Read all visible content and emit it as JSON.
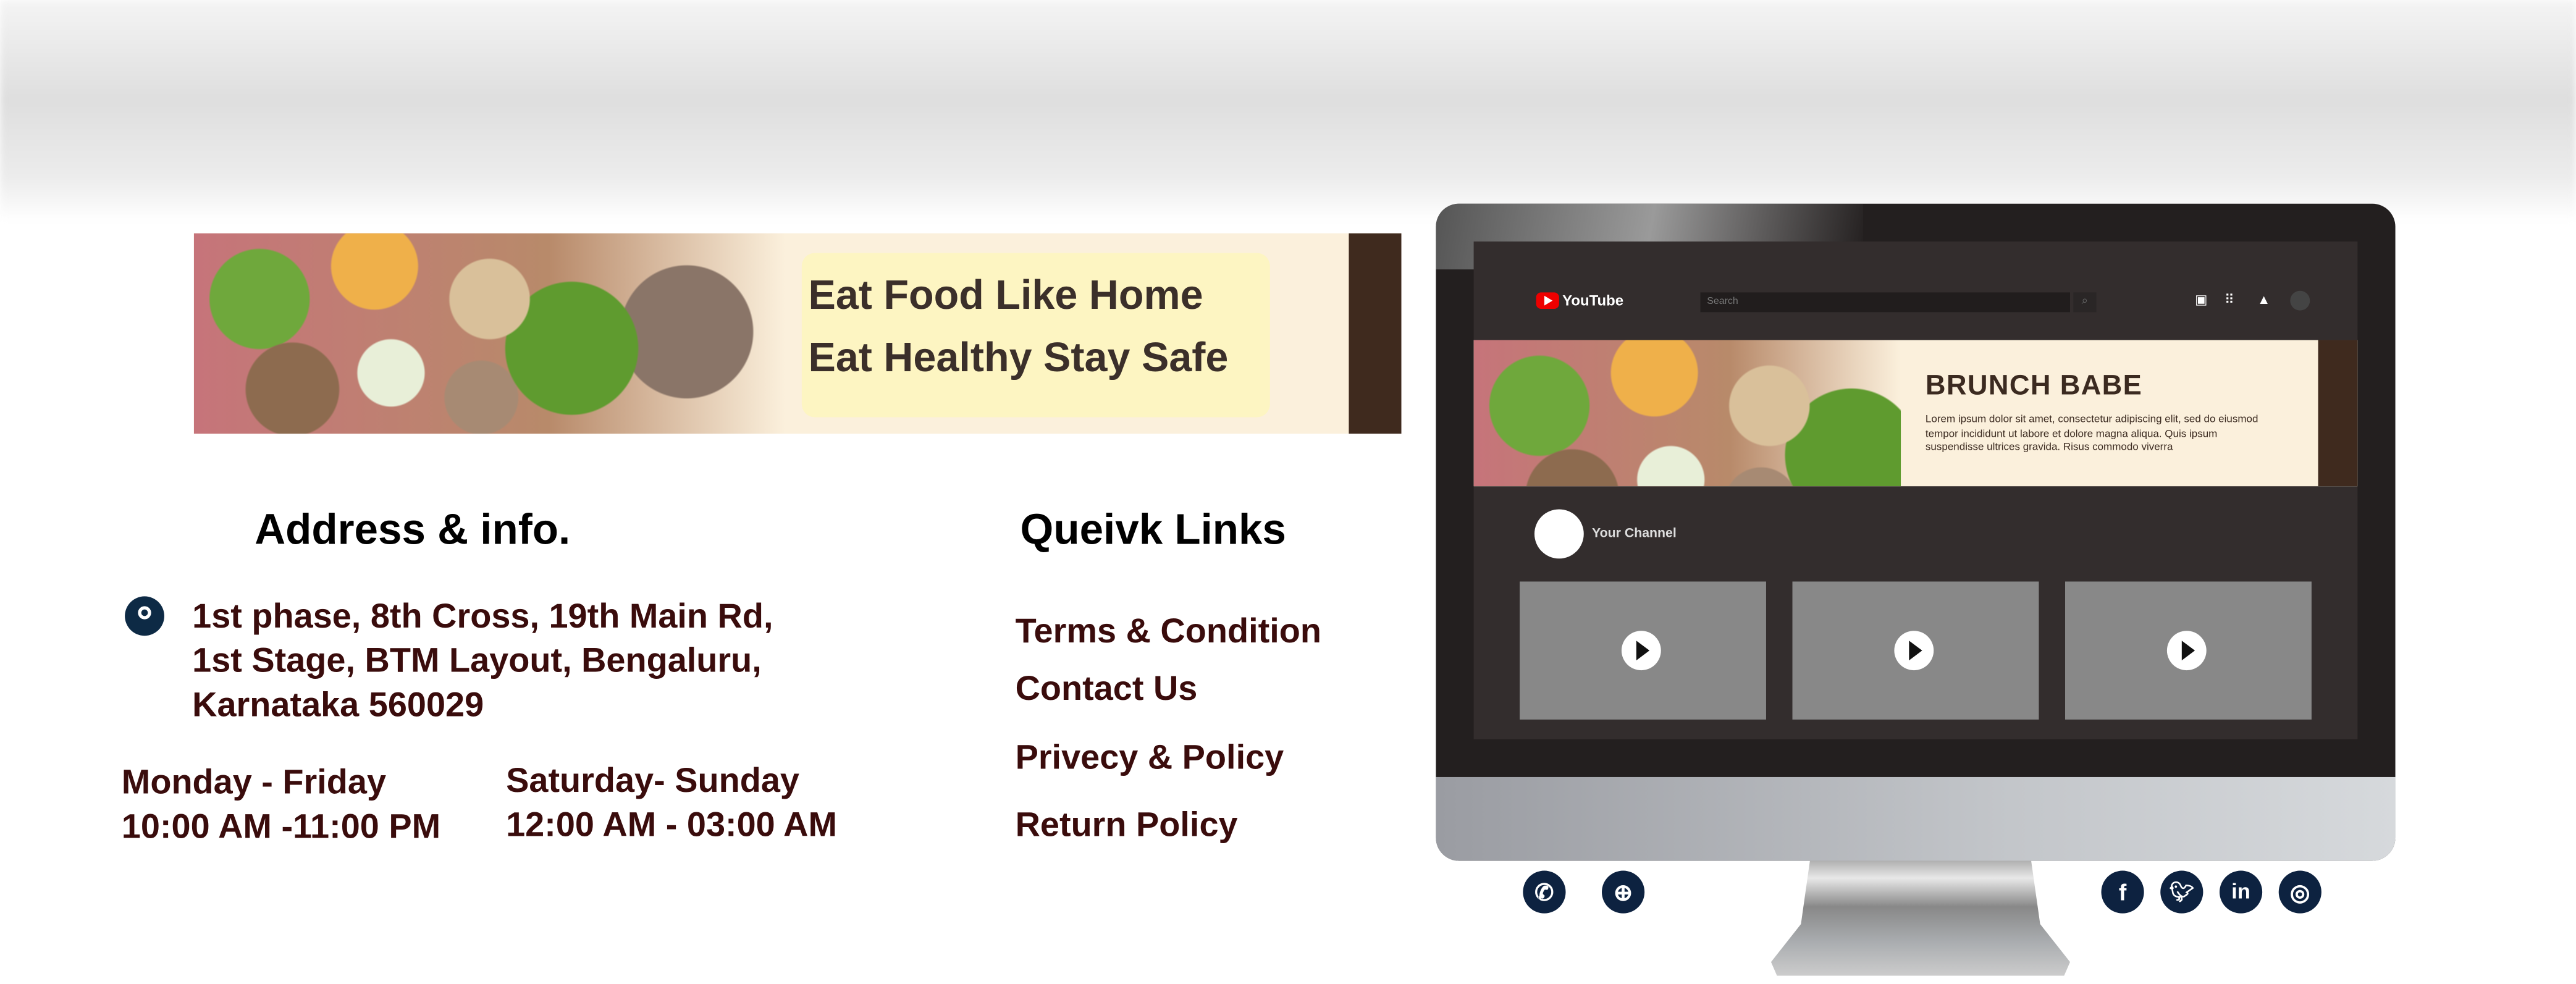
{
  "banner": {
    "line1": "Eat Food Like Home",
    "line2": "Eat Healthy Stay Safe"
  },
  "address": {
    "heading": "Address & info.",
    "lines": [
      "1st phase, 8th Cross, 19th Main Rd,",
      "1st Stage, BTM Layout, Bengaluru,",
      "Karnataka 560029"
    ],
    "icon": "location-pin-icon"
  },
  "hours": [
    {
      "days": "Monday - Friday",
      "time": "10:00 AM -11:00 PM"
    },
    {
      "days": "Saturday- Sunday",
      "time": "12:00 AM - 03:00 AM"
    }
  ],
  "links": {
    "heading": "Queivk Links",
    "items": [
      "Terms & Condition",
      "Contact Us",
      "Privecy & Policy",
      "Return Policy"
    ]
  },
  "youtube": {
    "logo": "YouTube",
    "search_placeholder": "Search",
    "banner_title": "BRUNCH BABE",
    "banner_text": "Lorem ipsum dolor sit amet, consectetur adipiscing elit, sed do eiusmod tempor incididunt ut labore et dolore magna aliqua. Quis ipsum suspendisse ultrices gravida. Risus commodo viverra",
    "channel": "Your Channel",
    "videos": 3
  },
  "contact_icons": [
    "phone-icon",
    "globe-icon"
  ],
  "social_icons": [
    "facebook-icon",
    "twitter-icon",
    "linkedin-icon",
    "instagram-icon"
  ],
  "colors": {
    "text": "#3a0c0c",
    "icon_bg": "#0d2240",
    "accent_brown": "#3f2a1e",
    "youtube_red": "#ee0000"
  }
}
